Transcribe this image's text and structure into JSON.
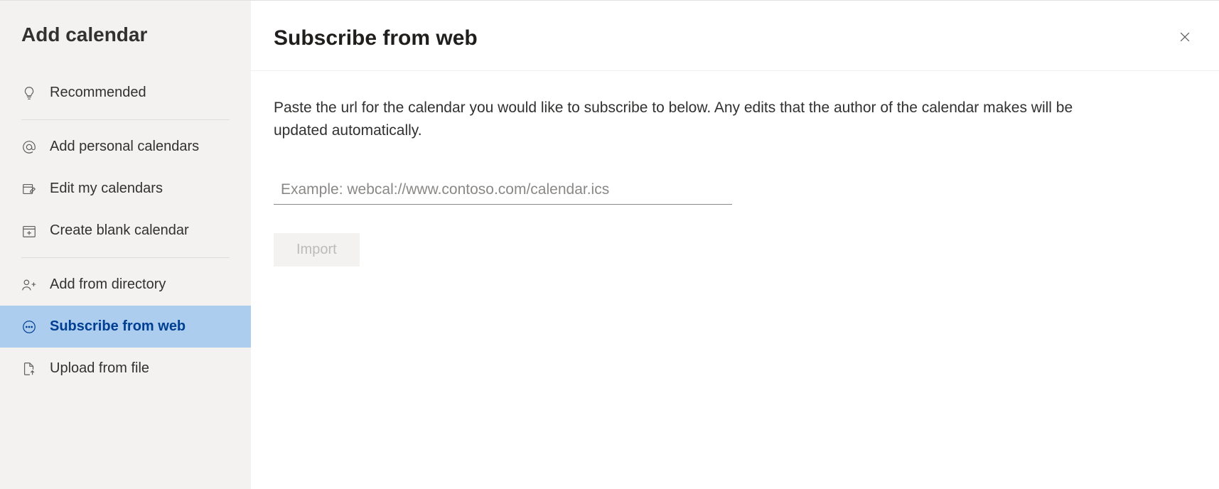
{
  "sidebar": {
    "title": "Add calendar",
    "groups": [
      {
        "items": [
          {
            "id": "recommended",
            "label": "Recommended",
            "icon": "lightbulb",
            "active": false
          }
        ]
      },
      {
        "items": [
          {
            "id": "add-personal",
            "label": "Add personal calendars",
            "icon": "at",
            "active": false
          },
          {
            "id": "edit-my",
            "label": "Edit my calendars",
            "icon": "edit-calendar",
            "active": false
          },
          {
            "id": "create-blank",
            "label": "Create blank calendar",
            "icon": "calendar-plus",
            "active": false
          }
        ]
      },
      {
        "items": [
          {
            "id": "add-directory",
            "label": "Add from directory",
            "icon": "people",
            "active": false
          },
          {
            "id": "subscribe-web",
            "label": "Subscribe from web",
            "icon": "web-dots",
            "active": true
          },
          {
            "id": "upload-file",
            "label": "Upload from file",
            "icon": "file-upload",
            "active": false
          }
        ]
      }
    ]
  },
  "main": {
    "title": "Subscribe from web",
    "description": "Paste the url for the calendar you would like to subscribe to below. Any edits that the author of the calendar makes will be updated automatically.",
    "url_input": {
      "value": "",
      "placeholder": "Example: webcal://www.contoso.com/calendar.ics"
    },
    "import_button_label": "Import"
  }
}
